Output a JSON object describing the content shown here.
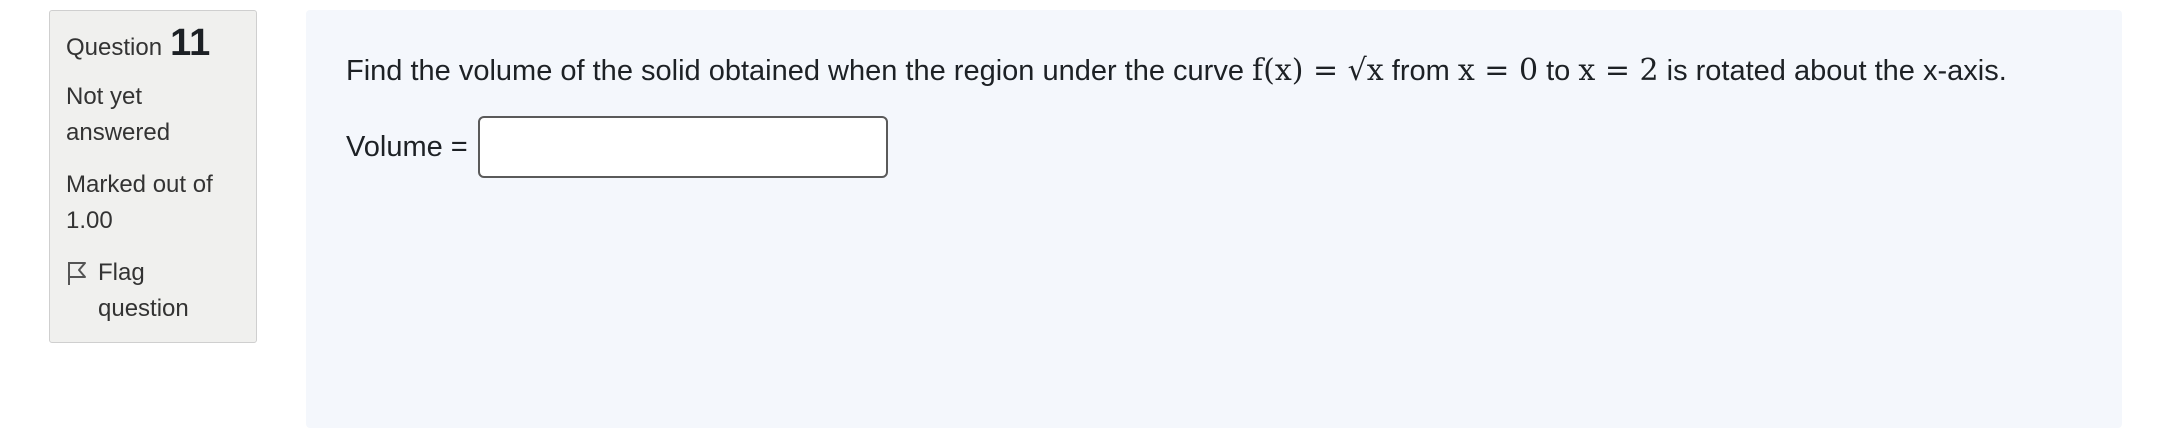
{
  "question_info": {
    "label": "Question",
    "number": "11",
    "state": "Not yet answered",
    "grade": "Marked out of 1.00",
    "flag_label": "Flag question",
    "flag_icon": "flag-icon"
  },
  "question": {
    "text_before": "Find the volume of the solid obtained when the region under the curve ",
    "math_fx": "f(x) = √x",
    "text_from": " from ",
    "math_x0": "x = 0",
    "text_to": " to ",
    "math_x2": "x = 2",
    "text_after": " is rotated about the x-axis.",
    "answer_label": "Volume =",
    "answer_value": ""
  }
}
